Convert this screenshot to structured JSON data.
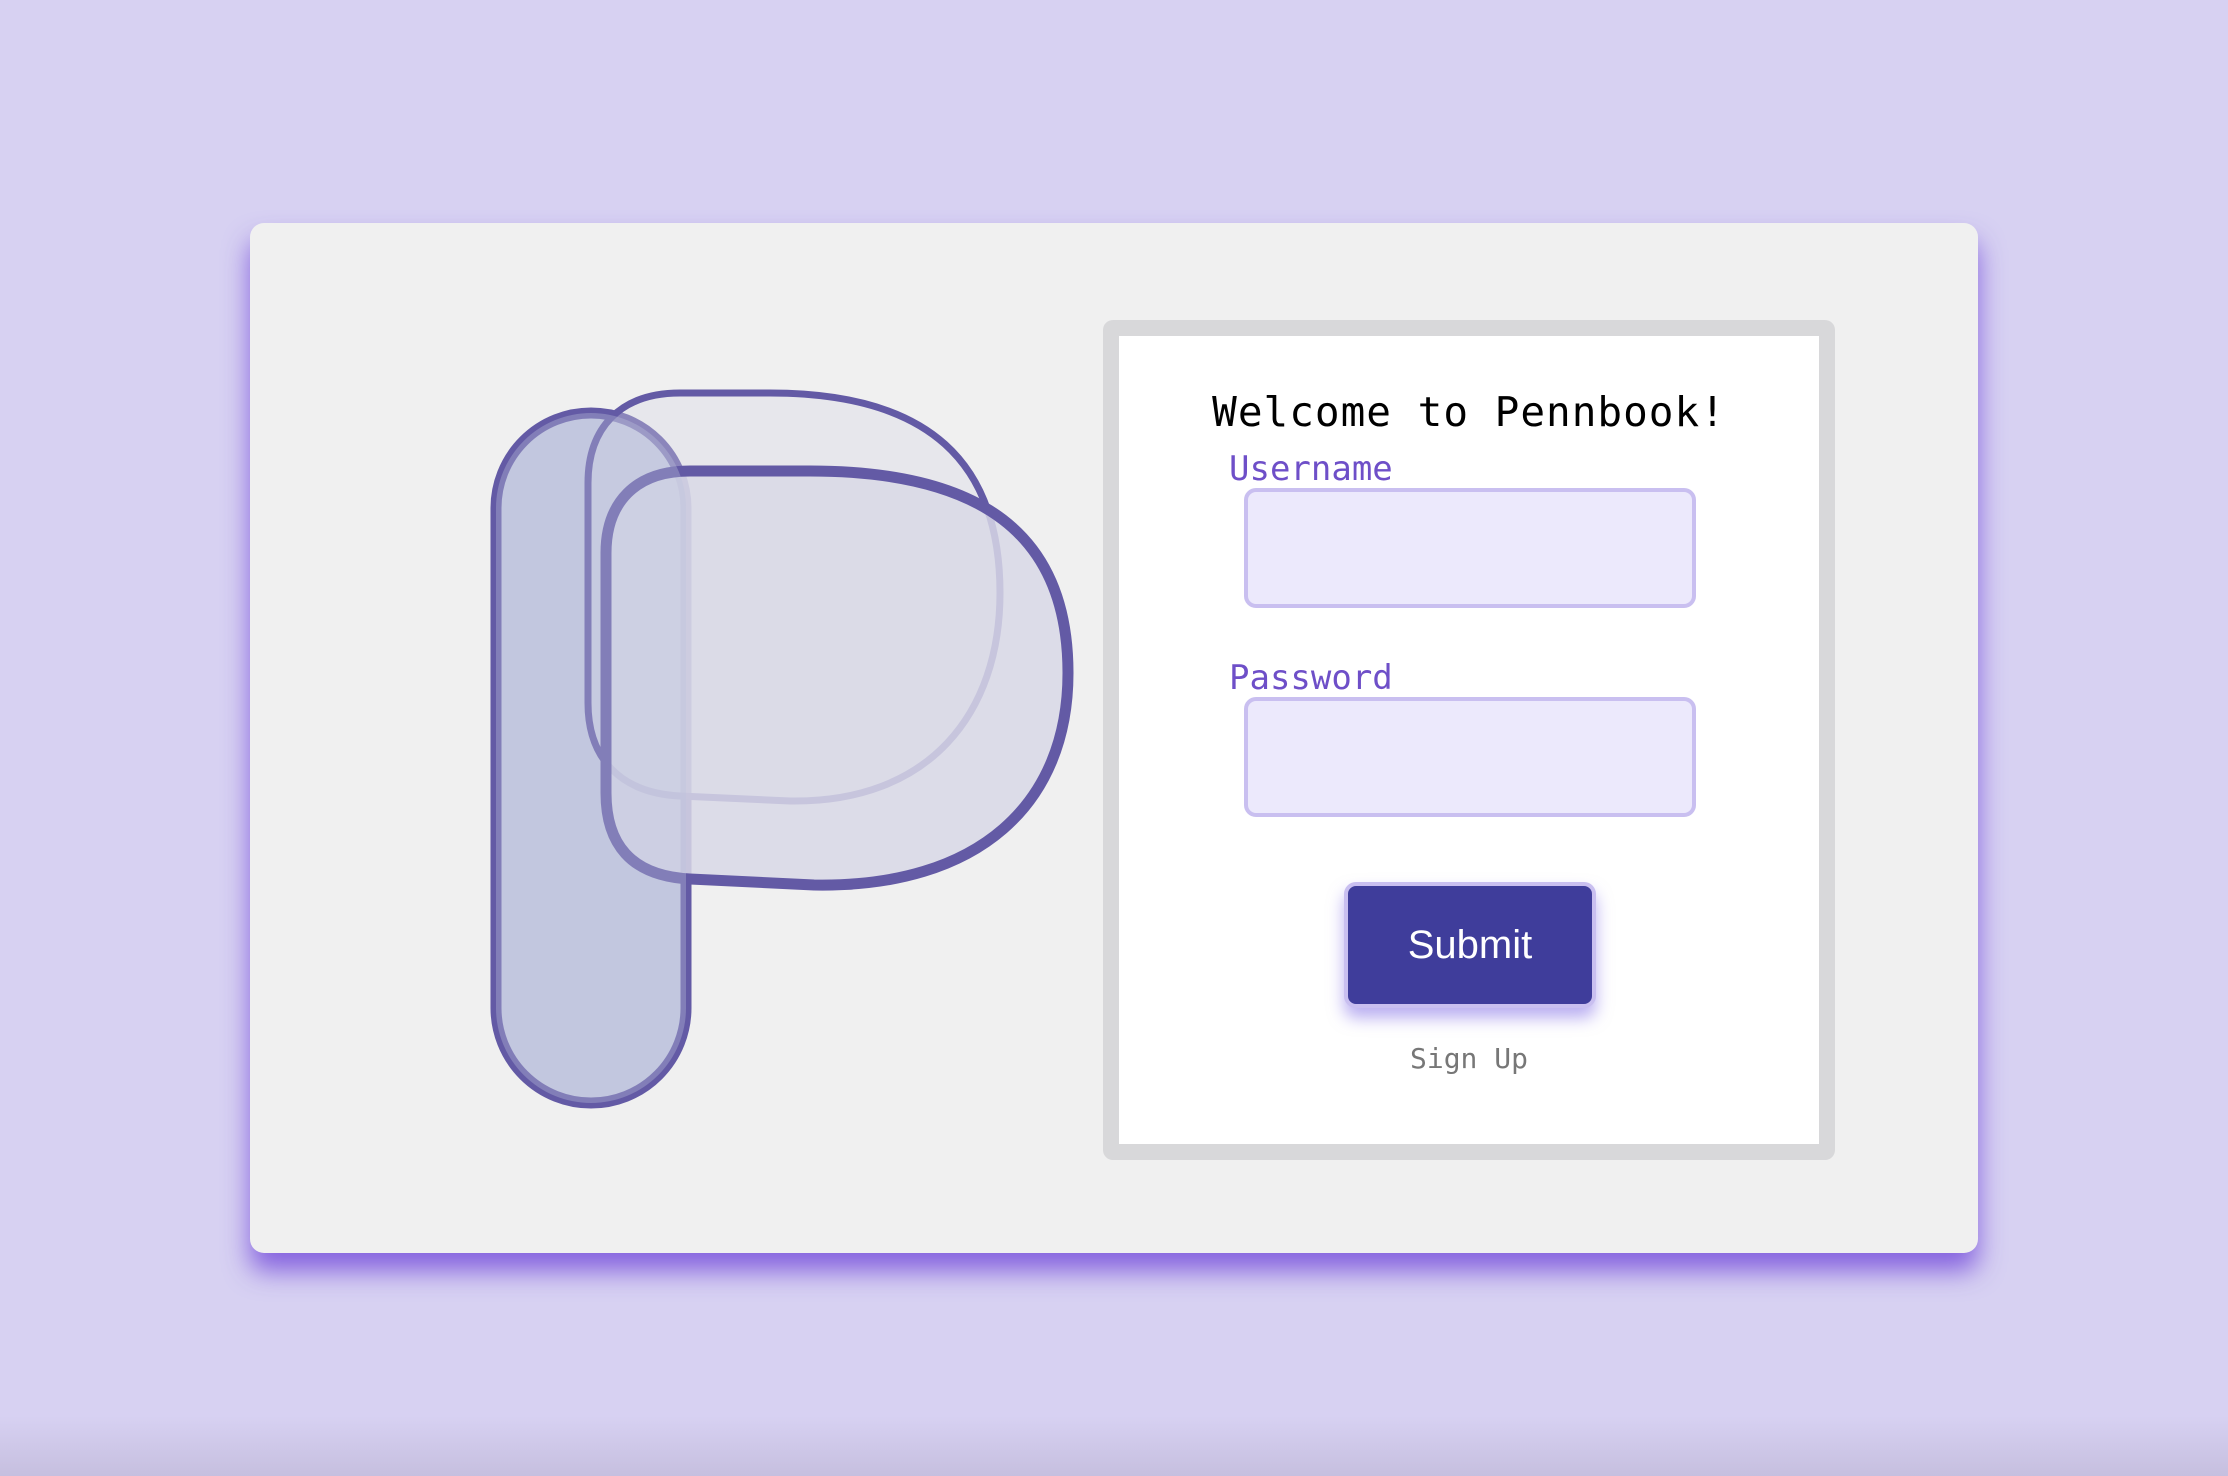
{
  "app": {
    "logo_name": "pennbook-p-logo"
  },
  "form": {
    "title": "Welcome to Pennbook!",
    "username_label": "Username",
    "username_value": "",
    "password_label": "Password",
    "password_value": "",
    "submit_label": "Submit",
    "signup_label": "Sign Up"
  },
  "colors": {
    "background": "#d7d1f2",
    "card": "#f0f0f0",
    "accent": "#6e4fc8",
    "button": "#3f3d9b",
    "logo_stroke": "#635aa5"
  }
}
